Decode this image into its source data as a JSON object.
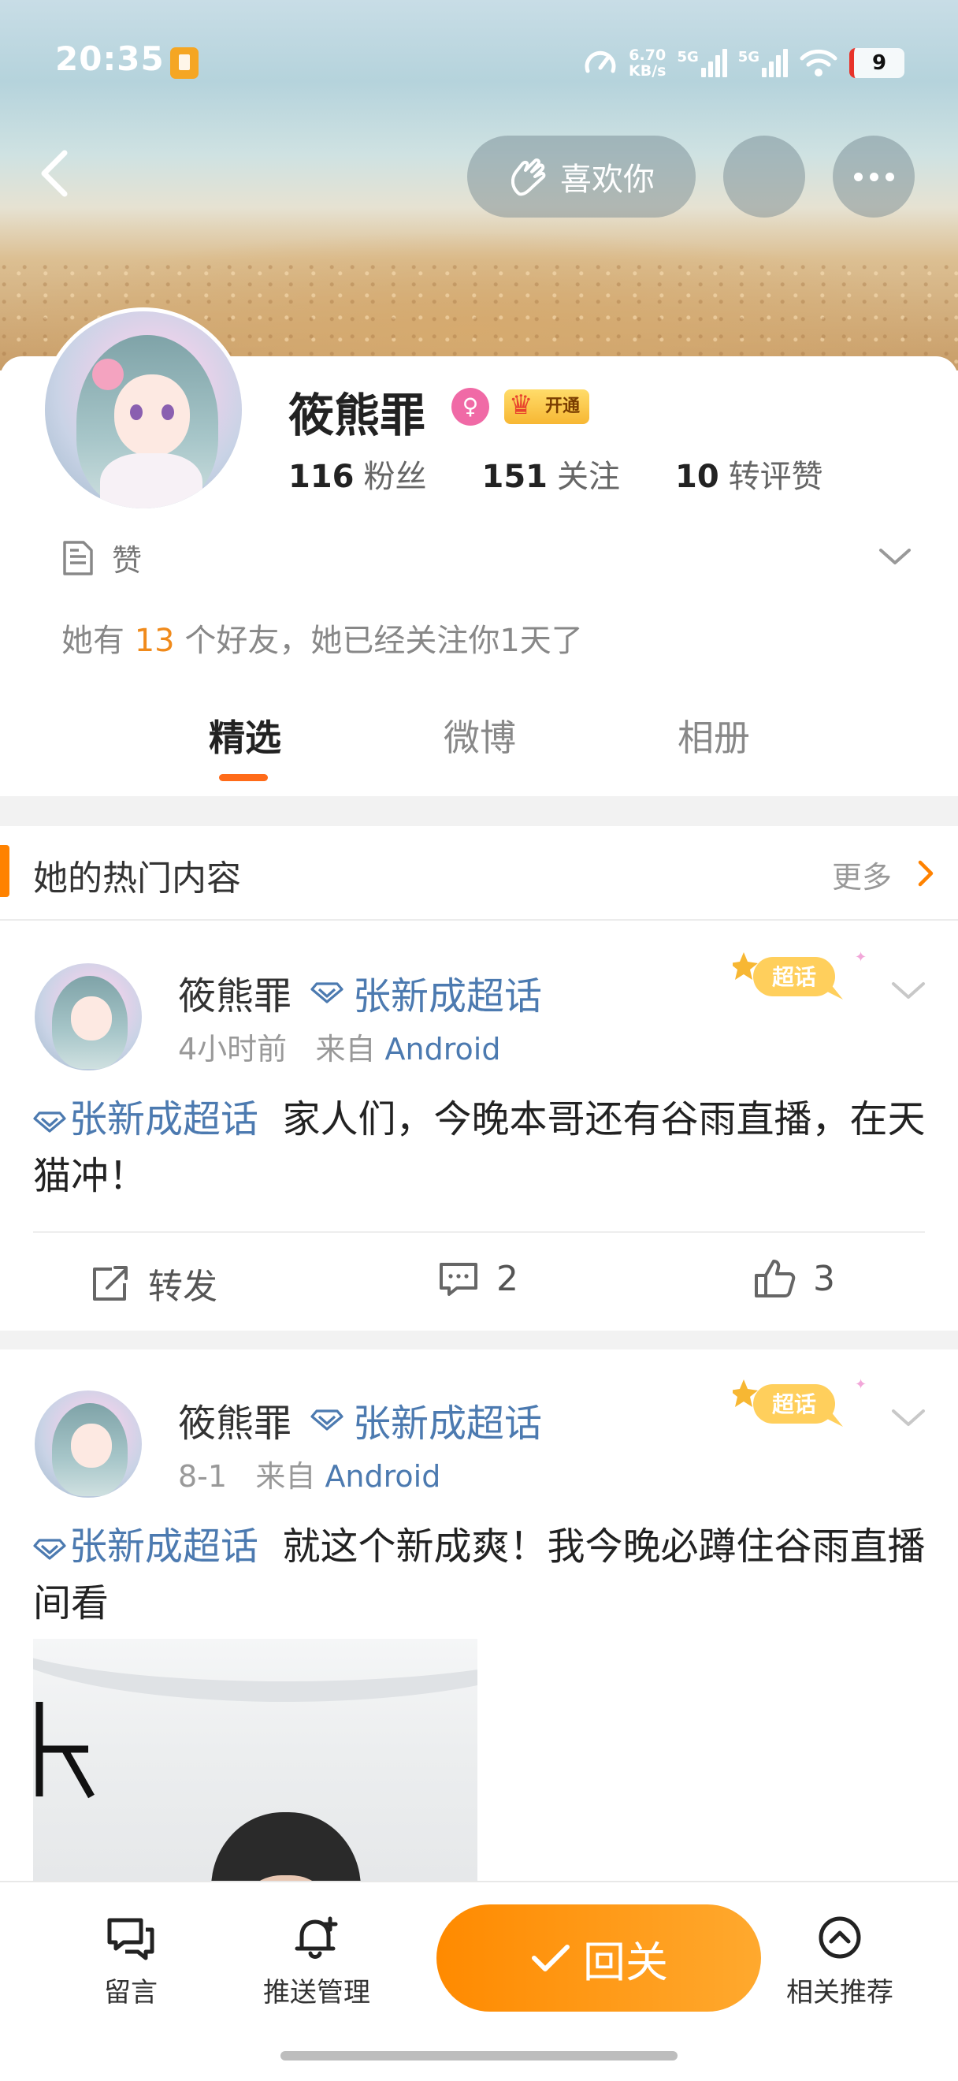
{
  "status_bar": {
    "time": "20:35",
    "net_speed_value": "6.70",
    "net_speed_unit": "KB/s",
    "signal_1": "5G",
    "signal_2": "5G",
    "battery": "9"
  },
  "header": {
    "like_you_label": "喜欢你"
  },
  "profile": {
    "name": "筱熊罪",
    "vip_label": "开通",
    "stats": [
      {
        "value": "116",
        "label": "粉丝"
      },
      {
        "value": "151",
        "label": "关注"
      },
      {
        "value": "10",
        "label": "转评赞"
      }
    ],
    "like_label": "赞",
    "friends_prefix": "她有",
    "friends_count": "13",
    "friends_suffix": "个好友，她已经关注你1天了"
  },
  "tabs": [
    {
      "label": "精选",
      "active": true
    },
    {
      "label": "微博",
      "active": false
    },
    {
      "label": "相册",
      "active": false
    }
  ],
  "hot_section": {
    "title": "她的热门内容",
    "more_label": "更多"
  },
  "posts": [
    {
      "author": "筱熊罪",
      "topic": "张新成超话",
      "time": "4小时前",
      "from_label": "来自",
      "source": "Android",
      "badge": "超话",
      "text_tag": "张新成超话",
      "text": "家人们，今晚本哥还有谷雨直播，在天猫冲！",
      "actions": {
        "repost_label": "转发",
        "comment_count": "2",
        "like_count": "3"
      }
    },
    {
      "author": "筱熊罪",
      "topic": "张新成超话",
      "time": "8-1",
      "from_label": "来自",
      "source": "Android",
      "badge": "超话",
      "text_tag": "张新成超话",
      "text": "就这个新成爽！我今晚必蹲住谷雨直播间看"
    }
  ],
  "bottom_bar": {
    "message_label": "留言",
    "push_label": "推送管理",
    "follow_back_label": "回关",
    "related_label": "相关推荐"
  },
  "colors": {
    "accent_orange": "#ff8200",
    "link_blue": "#4c7ab0",
    "highlight_count": "#f08a1b"
  }
}
